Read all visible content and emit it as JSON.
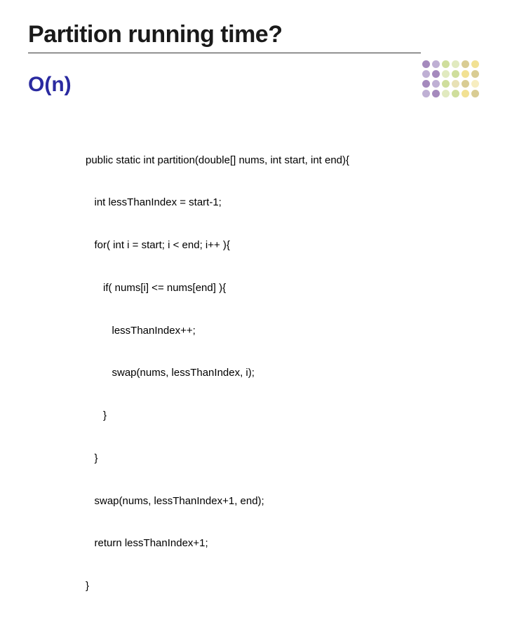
{
  "slide": {
    "title": "Partition running time?",
    "subtitle": "O(n)"
  },
  "code": {
    "lines": [
      "public static int partition(double[] nums, int start, int end){",
      "   int lessThanIndex = start-1;",
      "   for( int i = start; i < end; i++ ){",
      "      if( nums[i] <= nums[end] ){",
      "         lessThanIndex++;",
      "         swap(nums, lessThanIndex, i);",
      "      }",
      "   }",
      "   swap(nums, lessThanIndex+1, end);",
      "   return lessThanIndex+1;",
      "}"
    ]
  }
}
